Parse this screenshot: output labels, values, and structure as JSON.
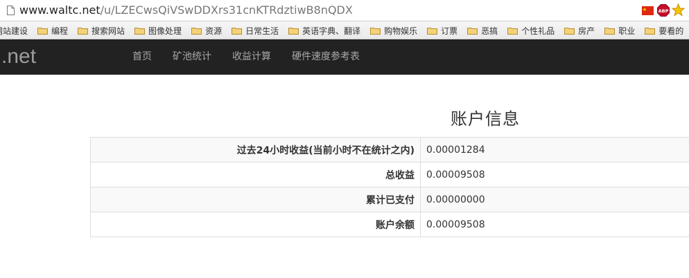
{
  "browser": {
    "url_host": "www.waltc.net",
    "url_path": "/u/LZECwsQiVSwDDXrs31cnKTRdztiwB8nQDX",
    "ext_abp_label": "ABP"
  },
  "bookmarks": [
    {
      "label": "网站建设"
    },
    {
      "label": "编程"
    },
    {
      "label": "搜索网站"
    },
    {
      "label": "图像处理"
    },
    {
      "label": "资源"
    },
    {
      "label": "日常生活"
    },
    {
      "label": "英语字典、翻译"
    },
    {
      "label": "购物娱乐"
    },
    {
      "label": "订票"
    },
    {
      "label": "恶搞"
    },
    {
      "label": "个性礼品"
    },
    {
      "label": "房产"
    },
    {
      "label": "职业"
    },
    {
      "label": "要看的"
    }
  ],
  "nav": {
    "brand": ".net",
    "links": [
      {
        "label": "首页"
      },
      {
        "label": "矿池统计"
      },
      {
        "label": "收益计算"
      },
      {
        "label": "硬件速度参考表"
      }
    ]
  },
  "account": {
    "title": "账户信息",
    "rows": [
      {
        "label": "过去24小时收益(当前小时不在统计之内)",
        "value": "0.00001284"
      },
      {
        "label": "总收益",
        "value": "0.00009508"
      },
      {
        "label": "累计已支付",
        "value": "0.00000000"
      },
      {
        "label": "账户余额",
        "value": "0.00009508"
      }
    ]
  },
  "colors": {
    "nav_bg": "#222222",
    "nav_text": "#a9a9a9",
    "table_border": "#dddddd",
    "stripe": "#f9f9f9"
  }
}
